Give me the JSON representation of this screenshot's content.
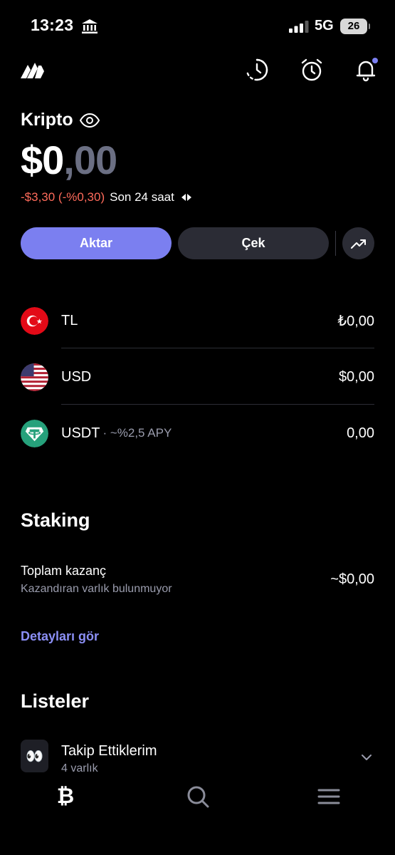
{
  "status_bar": {
    "time": "13:23",
    "network": "5G",
    "battery": "26"
  },
  "header": {
    "title": "Kripto"
  },
  "balance": {
    "integer": "$0",
    "decimals": ",00"
  },
  "change": {
    "amount": "-$3,30 (-%0,30)",
    "period": "Son 24 saat"
  },
  "actions": {
    "transfer_label": "Aktar",
    "withdraw_label": "Çek"
  },
  "assets": [
    {
      "name": "TL",
      "sub": "",
      "value": "₺0,00",
      "icon": "turkey-flag-icon"
    },
    {
      "name": "USD",
      "sub": "",
      "value": "$0,00",
      "icon": "us-flag-icon"
    },
    {
      "name": "USDT",
      "sub": "· ~%2,5 APY",
      "value": "0,00",
      "icon": "tether-icon"
    }
  ],
  "staking": {
    "title": "Staking",
    "label": "Toplam kazanç",
    "sub": "Kazandıran varlık bulunmuyor",
    "value": "~$0,00",
    "link": "Detayları gör"
  },
  "lists": {
    "title": "Listeler",
    "items": [
      {
        "title": "Takip Ettiklerim",
        "sub": "4 varlık",
        "icon": "👀"
      }
    ]
  },
  "tabs": {
    "crypto_glyph": "₿"
  },
  "colors": {
    "accent": "#7b7ff0",
    "negative": "#ff6b5b",
    "surface": "#2b2c35"
  }
}
